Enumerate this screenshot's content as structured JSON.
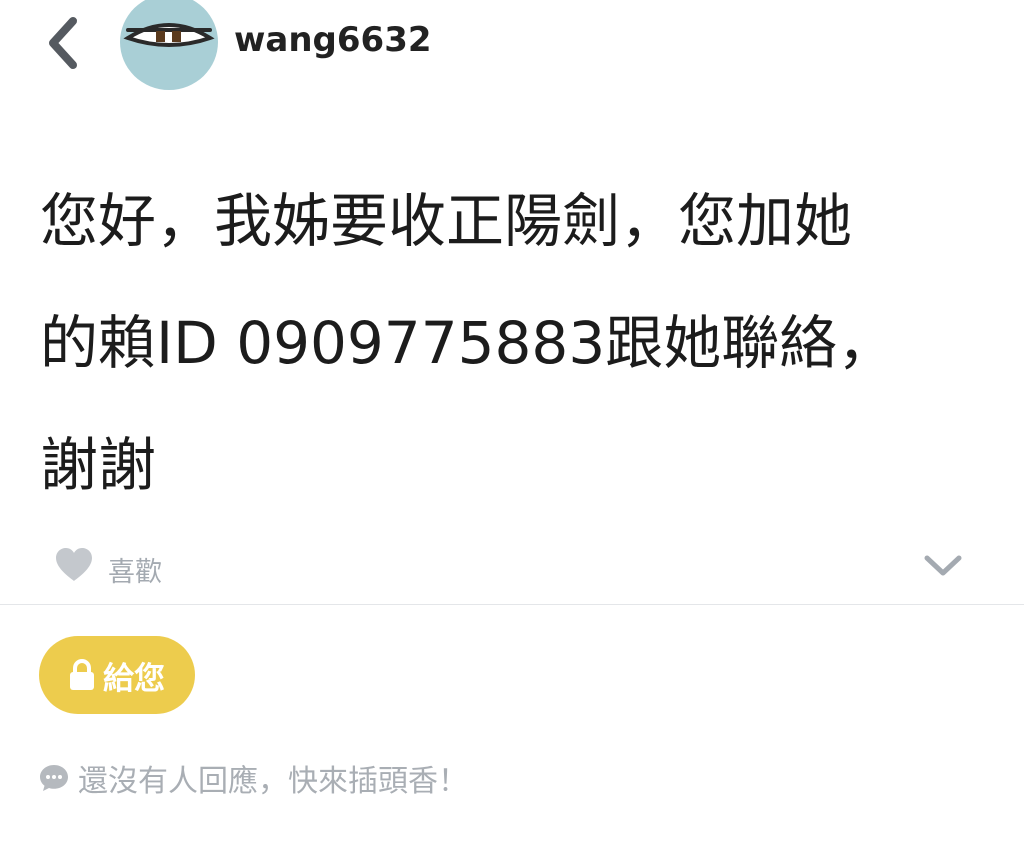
{
  "header": {
    "back_icon": "chevron-left-icon",
    "avatar_icon": "sleepy-eye-avatar",
    "username": "wang6632"
  },
  "post": {
    "line1": "您好，我姊要收正陽劍，您加她",
    "line2": "的賴ID 0909775883跟她聯絡，",
    "line3": "謝謝"
  },
  "actions": {
    "like_icon": "heart-icon",
    "like_label": "喜歡",
    "expand_icon": "chevron-down-icon"
  },
  "give": {
    "icon": "lock-icon",
    "label": "給您"
  },
  "replies": {
    "icon": "chat-bubble-icon",
    "empty_text": "還沒有人回應，快來插頭香！"
  },
  "colors": {
    "avatar_bg": "#a9cfd6",
    "give_button": "#edcc4d",
    "muted_text": "#a4aab1",
    "body_text": "#1c1c1c"
  }
}
